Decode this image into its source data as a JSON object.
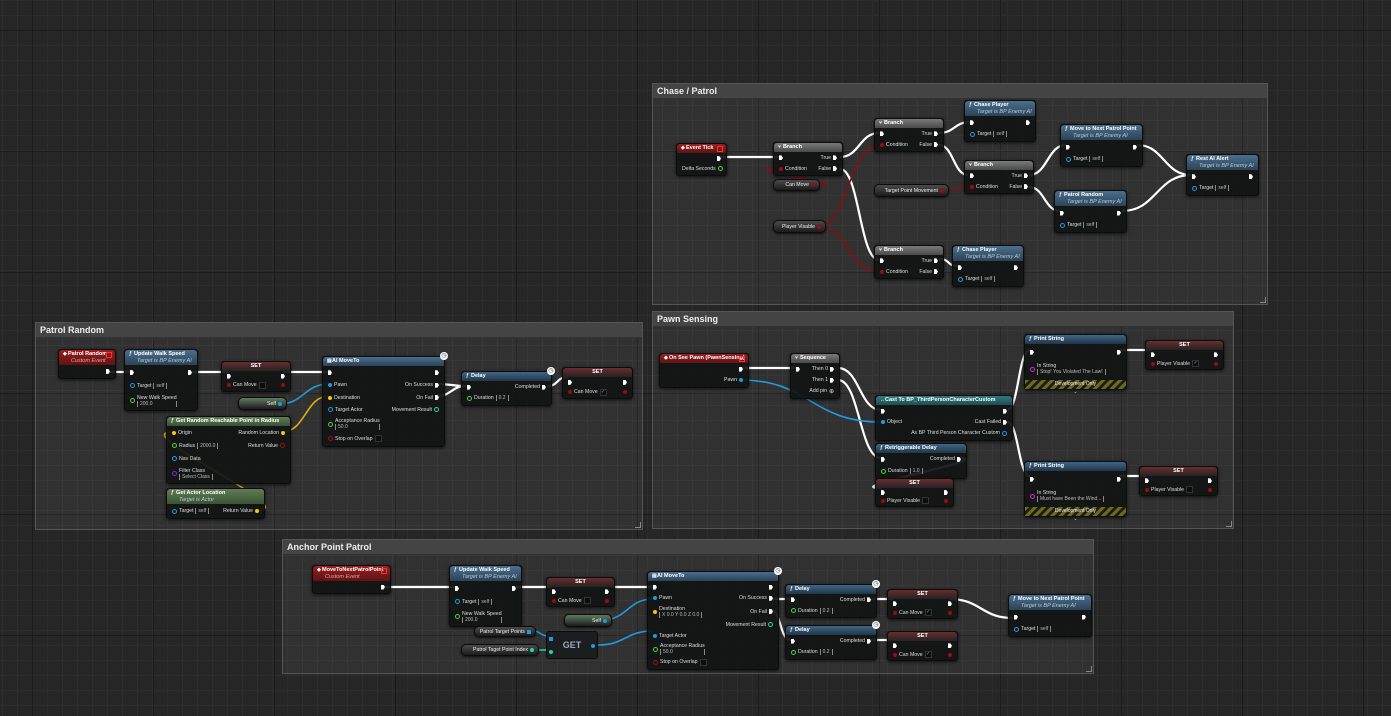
{
  "comments": [
    {
      "id": "chase_patrol",
      "title": "Chase / Patrol"
    },
    {
      "id": "patrol_random",
      "title": "Patrol Random"
    },
    {
      "id": "pawn_sensing",
      "title": "Pawn Sensing"
    },
    {
      "id": "anchor_point_patrol",
      "title": "Anchor Point Patrol"
    }
  ],
  "pin_colors": {
    "exec": "#ffffff",
    "bool": "#9b0d0d",
    "object": "#1d9ae0",
    "vector": "#f5c518",
    "float": "#4cd03a",
    "int": "#1fd9a4",
    "string": "#e01ed0",
    "class": "#7a2ad0"
  },
  "getters": [
    {
      "id": "cp_can_move",
      "label": "Can Move",
      "pin": "bool"
    },
    {
      "id": "cp_player_visable",
      "label": "Player Visable",
      "pin": "bool"
    },
    {
      "id": "cp_target_point_movement",
      "label": "Target Point Movement",
      "pin": "bool"
    },
    {
      "id": "pr_self",
      "label": "Self",
      "pin": "object",
      "self": true
    },
    {
      "id": "ap_self",
      "label": "Self",
      "pin": "object",
      "self": true
    },
    {
      "id": "ap_targets",
      "label": "Patrol Target Points",
      "pin": "array"
    },
    {
      "id": "ap_index",
      "label": "Patrol Taget Point Index",
      "pin": "int"
    }
  ],
  "get_node": {
    "label": "GET"
  },
  "nodes": [
    {
      "id": "cp_event_tick",
      "kind": "event",
      "icon": "event-icon",
      "title": "Event Tick",
      "rows": [
        [
          null,
          {
            "pin": "exec"
          }
        ],
        [
          null,
          {
            "label": "Delta Seconds",
            "pin": "float"
          }
        ]
      ]
    },
    {
      "id": "cp_branch1",
      "kind": "branch",
      "icon": "branch-icon",
      "title": "Branch",
      "rows": [
        [
          {
            "pin": "exec"
          },
          {
            "label": "True",
            "pin": "exec"
          }
        ],
        [
          {
            "label": "Condition",
            "pin": "bool"
          },
          {
            "label": "False",
            "pin": "exec"
          }
        ]
      ]
    },
    {
      "id": "cp_branch2",
      "kind": "branch",
      "icon": "branch-icon",
      "title": "Branch",
      "rows": [
        [
          {
            "pin": "exec"
          },
          {
            "label": "True",
            "pin": "exec"
          }
        ],
        [
          {
            "label": "Condition",
            "pin": "bool"
          },
          {
            "label": "False",
            "pin": "exec"
          }
        ]
      ]
    },
    {
      "id": "cp_branch3",
      "kind": "branch",
      "icon": "branch-icon",
      "title": "Branch",
      "rows": [
        [
          {
            "pin": "exec"
          },
          {
            "label": "True",
            "pin": "exec"
          }
        ],
        [
          {
            "label": "Condition",
            "pin": "bool"
          },
          {
            "label": "False",
            "pin": "exec"
          }
        ]
      ]
    },
    {
      "id": "cp_branch4",
      "kind": "branch",
      "icon": "branch-icon",
      "title": "Branch",
      "rows": [
        [
          {
            "pin": "exec"
          },
          {
            "label": "True",
            "pin": "exec"
          }
        ],
        [
          {
            "label": "Condition",
            "pin": "bool"
          },
          {
            "label": "False",
            "pin": "exec"
          }
        ]
      ]
    },
    {
      "id": "cp_chase1",
      "kind": "func",
      "icon": "function-icon",
      "title": "Chase Player",
      "subtitle": "Target is BP Enemy AI",
      "rows": [
        [
          {
            "pin": "exec"
          },
          {
            "pin": "exec"
          }
        ],
        [
          {
            "label": "Target",
            "pin": "outline-object",
            "value": "self"
          },
          null
        ]
      ]
    },
    {
      "id": "cp_move_next",
      "kind": "func",
      "icon": "function-icon",
      "title": "Move to Next Patrol Point",
      "subtitle": "Target is BP Enemy AI",
      "rows": [
        [
          {
            "pin": "exec"
          },
          {
            "pin": "exec"
          }
        ],
        [
          {
            "label": "Target",
            "pin": "outline-object",
            "value": "self"
          },
          null
        ]
      ]
    },
    {
      "id": "cp_patrol_random",
      "kind": "func",
      "icon": "function-icon",
      "title": "Patrol Random",
      "subtitle": "Target is BP Enemy AI",
      "rows": [
        [
          {
            "pin": "exec"
          },
          {
            "pin": "exec"
          }
        ],
        [
          {
            "label": "Target",
            "pin": "outline-object",
            "value": "self"
          },
          null
        ]
      ]
    },
    {
      "id": "cp_rest_alert",
      "kind": "func",
      "icon": "function-icon",
      "title": "Rest AI Alert",
      "subtitle": "Target is BP Enemy AI",
      "rows": [
        [
          {
            "pin": "exec"
          },
          {
            "pin": "exec"
          }
        ],
        [
          {
            "label": "Target",
            "pin": "outline-object",
            "value": "self"
          },
          null
        ]
      ]
    },
    {
      "id": "cp_chase2",
      "kind": "func",
      "icon": "function-icon",
      "title": "Chase Player",
      "subtitle": "Target is BP Enemy AI",
      "rows": [
        [
          {
            "pin": "exec"
          },
          {
            "pin": "exec"
          }
        ],
        [
          {
            "label": "Target",
            "pin": "outline-object",
            "value": "self"
          },
          null
        ]
      ]
    },
    {
      "id": "pr_event",
      "kind": "event",
      "icon": "event-icon",
      "title": "Patrol Random",
      "subtitle": "Custom Event",
      "rows": [
        [
          null,
          {
            "pin": "exec"
          }
        ]
      ]
    },
    {
      "id": "pr_uws",
      "kind": "func",
      "icon": "function-icon",
      "title": "Update Walk Speed",
      "subtitle": "Target is BP Enemy AI",
      "rows": [
        [
          {
            "pin": "exec"
          },
          {
            "pin": "exec"
          }
        ],
        [
          {
            "label": "Target",
            "pin": "outline-object",
            "value": "self"
          },
          null
        ],
        [
          {
            "label": "New Walk Speed",
            "pin": "float",
            "value": "200.0",
            "stacked": true
          },
          null
        ]
      ]
    },
    {
      "id": "pr_set1",
      "kind": "set",
      "title": "SET",
      "rows": [
        [
          {
            "pin": "exec"
          },
          {
            "pin": "exec"
          }
        ],
        [
          {
            "label": "Can Move",
            "pin": "bool",
            "check": false
          },
          {
            "pin": "bool"
          }
        ]
      ]
    },
    {
      "id": "pr_moveto",
      "kind": "func",
      "icon": "ai-moveto-icon",
      "title": "AI MoveTo",
      "latent": true,
      "rows": [
        [
          {
            "pin": "exec"
          },
          {
            "pin": "exec"
          }
        ],
        [
          {
            "label": "Pawn",
            "pin": "object"
          },
          {
            "label": "On Success",
            "pin": "exec"
          }
        ],
        [
          {
            "label": "Destination",
            "pin": "vector"
          },
          {
            "label": "On Fail",
            "pin": "exec"
          }
        ],
        [
          {
            "label": "Target Actor",
            "pin": "outline-object"
          },
          {
            "label": "Movement Result",
            "pin": "outline-int"
          }
        ],
        [
          {
            "label": "Acceptance Radius",
            "pin": "float",
            "value": "50.0",
            "stacked": true
          },
          null
        ],
        [
          {
            "label": "Stop on Overlap",
            "pin": "outline-bool",
            "check": false
          },
          null
        ]
      ]
    },
    {
      "id": "pr_random_point",
      "kind": "pure",
      "icon": "function-icon",
      "title": "Get Random Reachable Point in Radius",
      "rows": [
        [
          {
            "label": "Origin",
            "pin": "vector"
          },
          {
            "label": "Random Location",
            "pin": "vector"
          }
        ],
        [
          {
            "label": "Radius",
            "pin": "float",
            "value": "2000.0"
          },
          {
            "label": "Return Value",
            "pin": "outline-bool"
          }
        ],
        [
          {
            "label": "Nav Data",
            "pin": "outline-object"
          },
          null
        ],
        [
          {
            "label": "Filter Class",
            "pin": "class",
            "value": "Select Class",
            "stacked": true
          },
          null
        ]
      ]
    },
    {
      "id": "pr_actor_loc",
      "kind": "pure",
      "icon": "function-icon",
      "title": "Get Actor Location",
      "subtitle": "Target is Actor",
      "rows": [
        [
          {
            "label": "Target",
            "pin": "outline-object",
            "value": "self"
          },
          {
            "label": "Return Value",
            "pin": "vector"
          }
        ]
      ]
    },
    {
      "id": "pr_delay",
      "kind": "delay",
      "icon": "function-icon",
      "title": "Delay",
      "latent": true,
      "rows": [
        [
          {
            "pin": "exec"
          },
          {
            "label": "Completed",
            "pin": "exec"
          }
        ],
        [
          {
            "label": "Duration",
            "pin": "float",
            "value": "0.2"
          },
          null
        ]
      ]
    },
    {
      "id": "pr_set2",
      "kind": "set",
      "title": "SET",
      "rows": [
        [
          {
            "pin": "exec"
          },
          {
            "pin": "exec"
          }
        ],
        [
          {
            "label": "Can Move",
            "pin": "bool",
            "check": true
          },
          {
            "pin": "bool"
          }
        ]
      ]
    },
    {
      "id": "ps_event",
      "kind": "event",
      "icon": "event-icon",
      "title": "On See Pawn (PawnSensing)",
      "rows": [
        [
          null,
          {
            "pin": "exec"
          }
        ],
        [
          null,
          {
            "label": "Pawn",
            "pin": "object"
          }
        ]
      ]
    },
    {
      "id": "ps_sequence",
      "kind": "branch",
      "icon": "sequence-icon",
      "title": "Sequence",
      "rows": [
        [
          {
            "pin": "exec"
          },
          {
            "label": "Then 0",
            "pin": "exec"
          }
        ],
        [
          null,
          {
            "label": "Then 1",
            "pin": "exec"
          }
        ],
        [
          null,
          {
            "label": "Add pin",
            "pin": "add"
          }
        ]
      ]
    },
    {
      "id": "ps_cast",
      "kind": "cast",
      "icon": "cast-icon",
      "title": "Cast To BP_ThirdPersonCharacterCustom",
      "rows": [
        [
          {
            "pin": "exec"
          },
          {
            "pin": "exec"
          }
        ],
        [
          {
            "label": "Object",
            "pin": "object"
          },
          {
            "label": "Cast Failed",
            "pin": "exec"
          }
        ],
        [
          null,
          {
            "label": "As BP Third Person Character Custom",
            "pin": "outline-object"
          }
        ]
      ]
    },
    {
      "id": "ps_retrig",
      "kind": "delay",
      "icon": "function-icon",
      "title": "Retriggerable Delay",
      "rows": [
        [
          {
            "pin": "exec"
          },
          {
            "label": "Completed",
            "pin": "exec"
          }
        ],
        [
          {
            "label": "Duration",
            "pin": "float",
            "value": "1.0"
          },
          null
        ]
      ]
    },
    {
      "id": "ps_set_bottom",
      "kind": "set",
      "title": "SET",
      "rows": [
        [
          {
            "pin": "exec"
          },
          {
            "pin": "exec"
          }
        ],
        [
          {
            "label": "Player Visable",
            "pin": "bool",
            "check": false
          },
          {
            "pin": "bool"
          }
        ]
      ]
    },
    {
      "id": "ps_print1",
      "kind": "delay",
      "icon": "function-icon",
      "title": "Print String",
      "footer": "Development Only",
      "rows": [
        [
          {
            "pin": "exec"
          },
          {
            "pin": "exec"
          }
        ],
        [
          {
            "label": "In String",
            "pin": "string",
            "value": "Stop! You Violated The Law!",
            "stacked": true
          },
          null
        ]
      ]
    },
    {
      "id": "ps_print2",
      "kind": "delay",
      "icon": "function-icon",
      "title": "Print String",
      "footer": "Development Only",
      "rows": [
        [
          {
            "pin": "exec"
          },
          {
            "pin": "exec"
          }
        ],
        [
          {
            "label": "In String",
            "pin": "string",
            "value": "Must have Been the Wind...",
            "stacked": true
          },
          null
        ]
      ]
    },
    {
      "id": "ps_set1",
      "kind": "set",
      "title": "SET",
      "rows": [
        [
          {
            "pin": "exec"
          },
          {
            "pin": "exec"
          }
        ],
        [
          {
            "label": "Player Visable",
            "pin": "bool",
            "check": true
          },
          {
            "pin": "bool"
          }
        ]
      ]
    },
    {
      "id": "ps_set2",
      "kind": "set",
      "title": "SET",
      "rows": [
        [
          {
            "pin": "exec"
          },
          {
            "pin": "exec"
          }
        ],
        [
          {
            "label": "Player Visable",
            "pin": "bool",
            "check": false
          },
          {
            "pin": "bool"
          }
        ]
      ]
    },
    {
      "id": "ap_event",
      "kind": "event",
      "icon": "event-icon",
      "title": "MoveToNextPatrolPoint",
      "subtitle": "Custom Event",
      "rows": [
        [
          null,
          {
            "pin": "exec"
          }
        ]
      ]
    },
    {
      "id": "ap_uws",
      "kind": "func",
      "icon": "function-icon",
      "title": "Update Walk Speed",
      "subtitle": "Target is BP Enemy AI",
      "rows": [
        [
          {
            "pin": "exec"
          },
          {
            "pin": "exec"
          }
        ],
        [
          {
            "label": "Target",
            "pin": "outline-object",
            "value": "self"
          },
          null
        ],
        [
          {
            "label": "New Walk Speed",
            "pin": "float",
            "value": "200.0",
            "stacked": true
          },
          null
        ]
      ]
    },
    {
      "id": "ap_set",
      "kind": "set",
      "title": "SET",
      "rows": [
        [
          {
            "pin": "exec"
          },
          {
            "pin": "exec"
          }
        ],
        [
          {
            "label": "Can Move",
            "pin": "bool",
            "check": false
          },
          {
            "pin": "bool"
          }
        ]
      ]
    },
    {
      "id": "ap_moveto",
      "kind": "func",
      "icon": "ai-moveto-icon",
      "title": "AI MoveTo",
      "latent": true,
      "rows": [
        [
          {
            "pin": "exec"
          },
          {
            "pin": "exec"
          }
        ],
        [
          {
            "label": "Pawn",
            "pin": "object"
          },
          {
            "label": "On Success",
            "pin": "exec"
          }
        ],
        [
          {
            "label": "Destination",
            "pin": "vector",
            "value": "X 0.0  Y 0.0  Z 0.0",
            "stacked": true
          },
          {
            "label": "On Fail",
            "pin": "exec"
          }
        ],
        [
          null,
          {
            "label": "Movement Result",
            "pin": "outline-int"
          }
        ],
        [
          {
            "label": "Target Actor",
            "pin": "object"
          },
          null
        ],
        [
          {
            "label": "Acceptance Radius",
            "pin": "float",
            "value": "50.0",
            "stacked": true
          },
          null
        ],
        [
          {
            "label": "Stop on Overlap",
            "pin": "outline-bool",
            "check": false
          },
          null
        ]
      ]
    },
    {
      "id": "ap_delay1",
      "kind": "delay",
      "icon": "function-icon",
      "title": "Delay",
      "latent": true,
      "rows": [
        [
          {
            "pin": "exec"
          },
          {
            "label": "Completed",
            "pin": "exec"
          }
        ],
        [
          {
            "label": "Duration",
            "pin": "float",
            "value": "0.2"
          },
          null
        ]
      ]
    },
    {
      "id": "ap_delay2",
      "kind": "delay",
      "icon": "function-icon",
      "title": "Delay",
      "latent": true,
      "rows": [
        [
          {
            "pin": "exec"
          },
          {
            "label": "Completed",
            "pin": "exec"
          }
        ],
        [
          {
            "label": "Duration",
            "pin": "float",
            "value": "0.2"
          },
          null
        ]
      ]
    },
    {
      "id": "ap_set_a",
      "kind": "set",
      "title": "SET",
      "rows": [
        [
          {
            "pin": "exec"
          },
          {
            "pin": "exec"
          }
        ],
        [
          {
            "label": "Can Move",
            "pin": "bool",
            "check": true
          },
          {
            "pin": "bool"
          }
        ]
      ]
    },
    {
      "id": "ap_set_b",
      "kind": "set",
      "title": "SET",
      "rows": [
        [
          {
            "pin": "exec"
          },
          {
            "pin": "exec"
          }
        ],
        [
          {
            "label": "Can Move",
            "pin": "bool",
            "check": true
          },
          {
            "pin": "bool"
          }
        ]
      ]
    },
    {
      "id": "ap_move_next",
      "kind": "func",
      "icon": "function-icon",
      "title": "Move to Next Patrol Point",
      "subtitle": "Target is BP Enemy AI",
      "rows": [
        [
          {
            "pin": "exec"
          },
          {
            "pin": "exec"
          }
        ],
        [
          {
            "label": "Target",
            "pin": "outline-object",
            "value": "self"
          },
          null
        ]
      ]
    }
  ]
}
